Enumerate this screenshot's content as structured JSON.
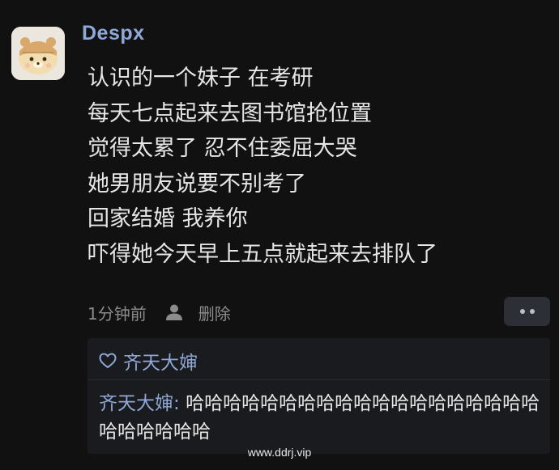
{
  "post": {
    "username": "Despx",
    "lines": [
      "认识的一个妹子 在考研",
      "每天七点起来去图书馆抢位置",
      "觉得太累了 忍不住委屈大哭",
      "她男朋友说要不别考了",
      "回家结婚 我养你",
      "吓得她今天早上五点就起来去排队了"
    ],
    "time": "1分钟前",
    "delete_label": "删除",
    "more_icon": "more-dots-icon",
    "user_icon": "user-icon"
  },
  "replies": {
    "like_icon": "heart-outline-icon",
    "liker": "齐天大婶",
    "comment_author": "齐天大婶",
    "comment_separator": ": ",
    "comment_text": "哈哈哈哈哈哈哈哈哈哈哈哈哈哈哈哈哈哈哈哈哈哈哈哈哈"
  },
  "watermark": "www.ddrj.vip",
  "colors": {
    "background": "#111111",
    "name_blue": "#8fa8d6",
    "text": "#e6e6e6",
    "meta_gray": "#8c8c8c",
    "panel": "#1a1b1f"
  }
}
